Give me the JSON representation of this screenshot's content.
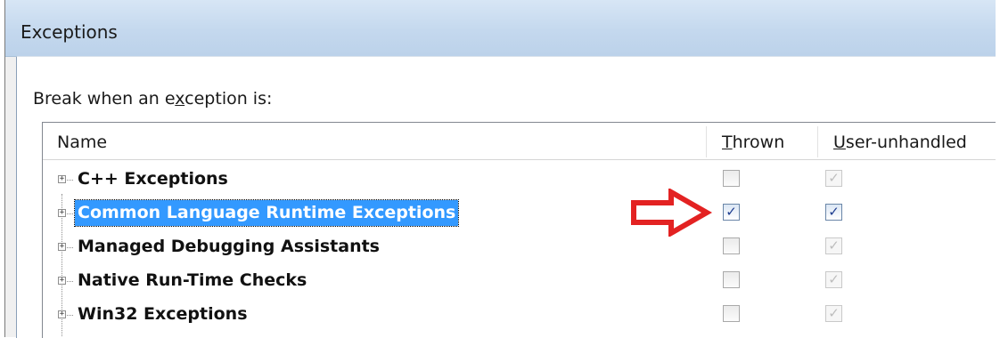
{
  "dialog": {
    "title": "Exceptions",
    "prompt_pre": "Break when an e",
    "prompt_u": "x",
    "prompt_post": "ception is:"
  },
  "columns": {
    "name": "Name",
    "thrown_u": "T",
    "thrown_rest": "hrown",
    "user_u": "U",
    "user_rest": "ser-unhandled"
  },
  "rows": [
    {
      "label": "C++ Exceptions",
      "selected": false,
      "thrown": false,
      "user_unhandled": true,
      "user_enabled": false
    },
    {
      "label": "Common Language Runtime Exceptions",
      "selected": true,
      "thrown": true,
      "user_unhandled": true,
      "user_enabled": true
    },
    {
      "label": "Managed Debugging Assistants",
      "selected": false,
      "thrown": false,
      "user_unhandled": true,
      "user_enabled": false
    },
    {
      "label": "Native Run-Time Checks",
      "selected": false,
      "thrown": false,
      "user_unhandled": true,
      "user_enabled": false
    },
    {
      "label": "Win32 Exceptions",
      "selected": false,
      "thrown": false,
      "user_unhandled": true,
      "user_enabled": false
    }
  ],
  "icons": {
    "expander": "plus-box-icon",
    "check": "check-icon",
    "annotation": "red-arrow-icon"
  },
  "colors": {
    "selection": "#3399ff",
    "annotation_arrow": "#e32222"
  },
  "glyphs": {
    "plus": "+",
    "check": "✓"
  }
}
